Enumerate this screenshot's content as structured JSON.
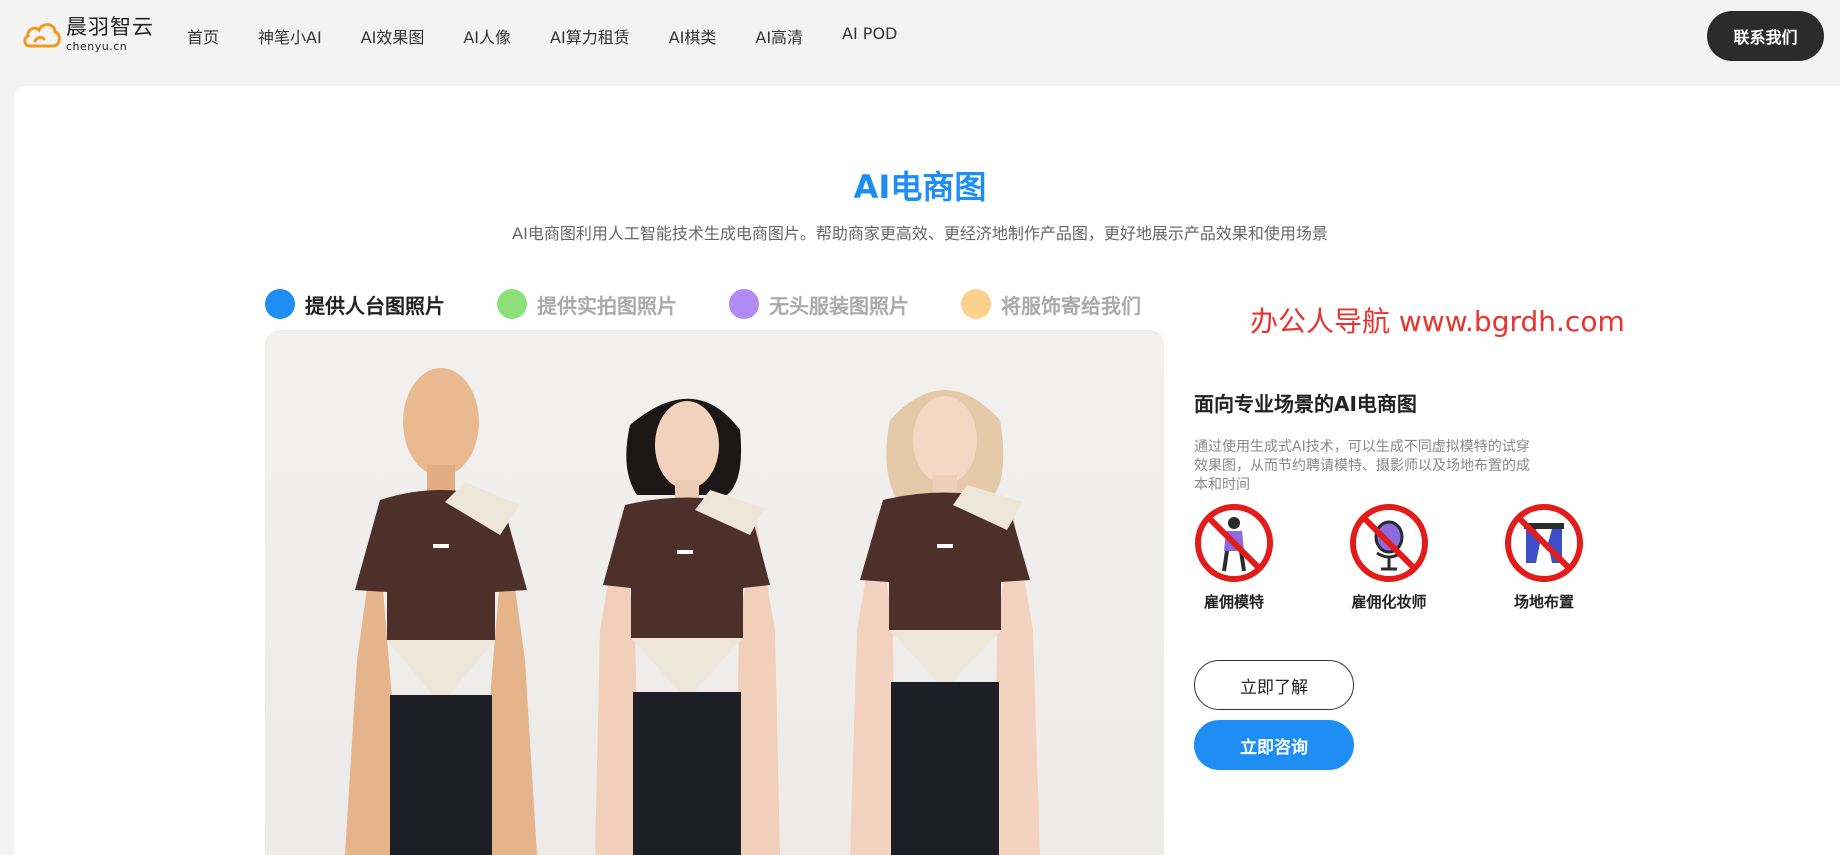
{
  "brand": {
    "name_cn": "晨羽智云",
    "name_en": "chenyu.cn",
    "accent": "#1e8ef5"
  },
  "nav": {
    "items": [
      {
        "label": "首页"
      },
      {
        "label": "神笔小AI"
      },
      {
        "label": "AI效果图"
      },
      {
        "label": "AI人像"
      },
      {
        "label": "AI算力租赁"
      },
      {
        "label": "AI棋类"
      },
      {
        "label": "AI高清"
      },
      {
        "label": "AI POD"
      }
    ],
    "contact_label": "联系我们"
  },
  "section": {
    "title": "AI电商图",
    "subtitle": "AI电商图利用人工智能技术生成电商图片。帮助商家更高效、更经济地制作产品图，更好地展示产品效果和使用场景"
  },
  "tabs": [
    {
      "label": "提供人台图照片",
      "color": "#1e8ef5",
      "active": true
    },
    {
      "label": "提供实拍图照片",
      "color": "#8ee07a",
      "active": false
    },
    {
      "label": "无头服装图照片",
      "color": "#b08cf5",
      "active": false
    },
    {
      "label": "将服饰寄给我们",
      "color": "#fbd08a",
      "active": false
    }
  ],
  "watermark": "办公人导航 www.bgrdh.com",
  "feature": {
    "title": "面向专业场景的AI电商图",
    "description": "通过使用生成式AI技术，可以生成不同虚拟模特的试穿效果图，从而节约聘请模特、摄影师以及场地布置的成本和时间",
    "savings": [
      {
        "label": "雇佣模特",
        "icon": "no-model-icon"
      },
      {
        "label": "雇佣化妆师",
        "icon": "no-makeup-artist-icon"
      },
      {
        "label": "场地布置",
        "icon": "no-venue-icon"
      }
    ],
    "learn_label": "立即了解",
    "consult_label": "立即咨询"
  }
}
